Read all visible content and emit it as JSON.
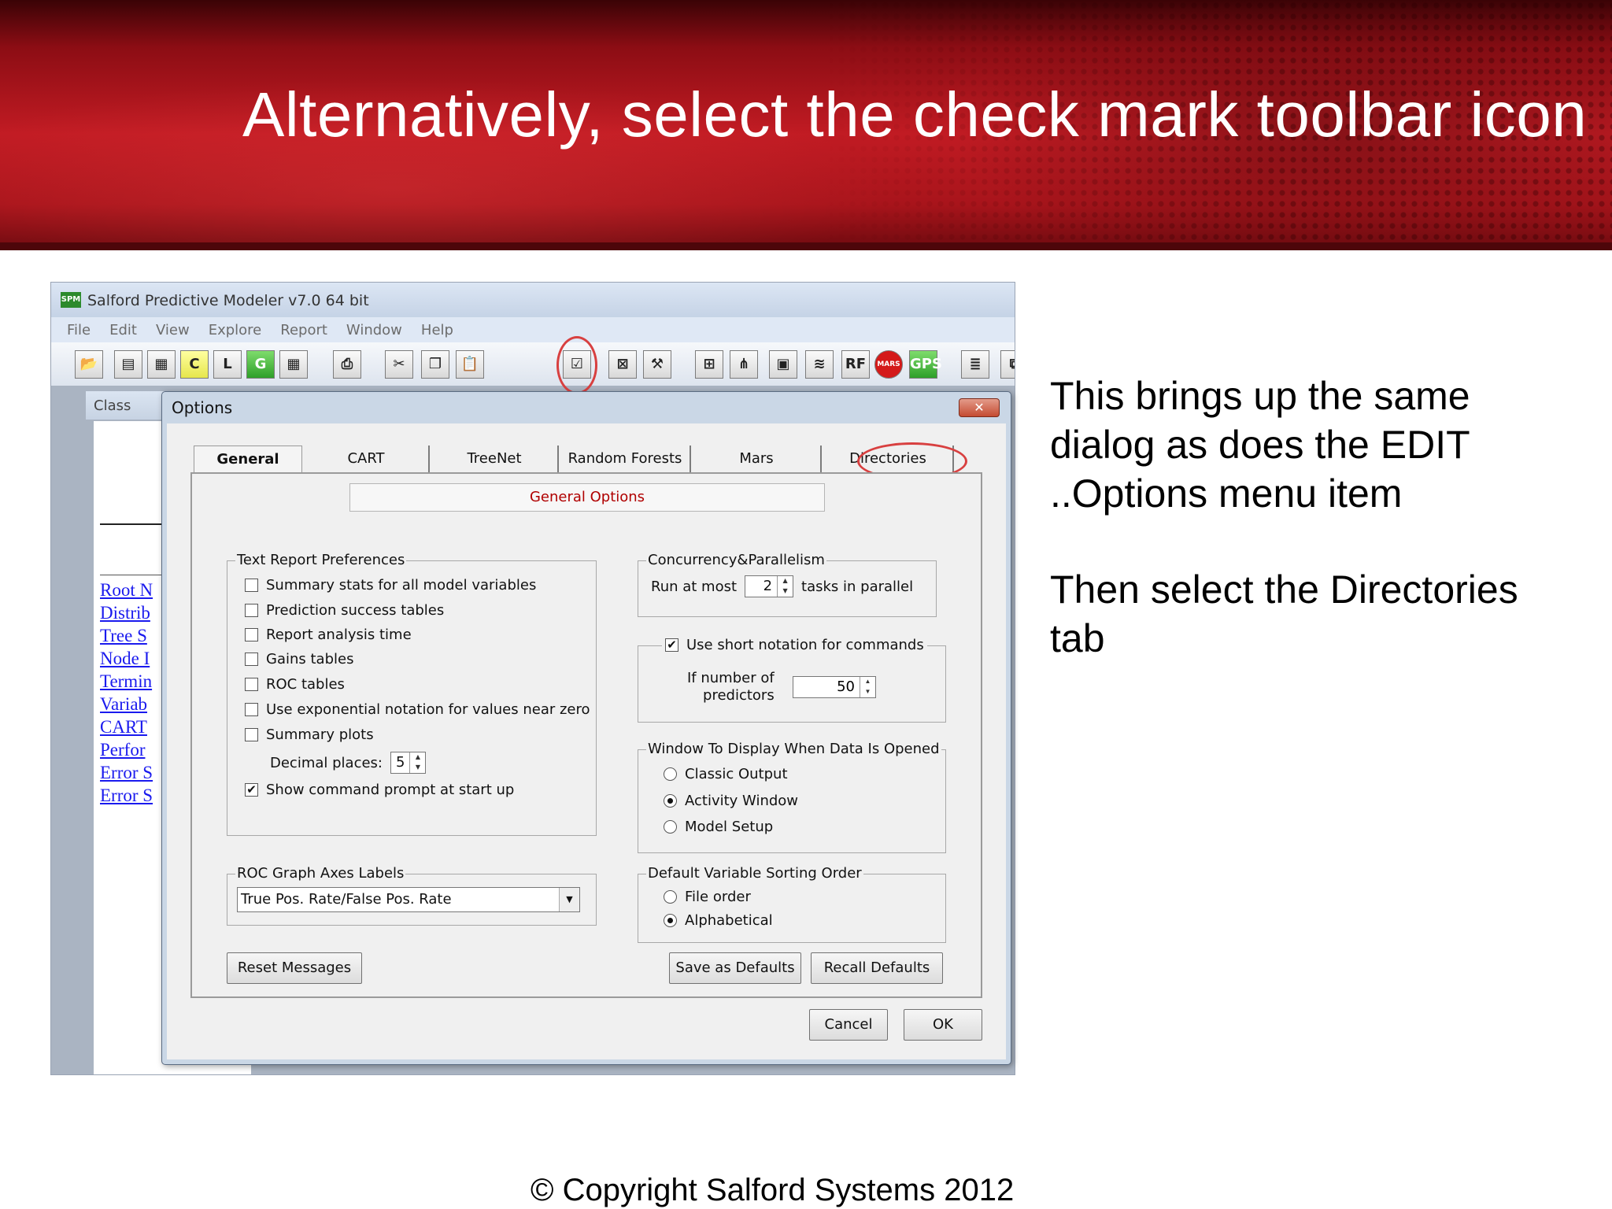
{
  "slide": {
    "title": "Alternatively, select the check mark toolbar icon",
    "side_text_1": "This brings up the same dialog as does the EDIT ..Options menu item",
    "side_text_2": "Then select the Directories tab",
    "copyright": "© Copyright Salford Systems 2012"
  },
  "app": {
    "logo": "SPM",
    "title": "Salford Predictive Modeler v7.0 64 bit",
    "menu": [
      "File",
      "Edit",
      "View",
      "Explore",
      "Report",
      "Window",
      "Help"
    ],
    "toolbar_icons": [
      "open-folder-icon",
      "properties-icon",
      "data-grid-icon",
      "c-icon",
      "l-icon",
      "g-icon",
      "table-icon",
      "print-icon",
      "cut-icon",
      "copy-icon",
      "paste-icon",
      "options-checkmark-icon",
      "model-icon",
      "tools-icon",
      "cart-icon",
      "treenet-icon",
      "votes-icon",
      "batteries-icon",
      "random-forests-icon",
      "mars-icon",
      "gps-icon",
      "report-icon",
      "window-icon"
    ]
  },
  "child_window": {
    "title": "Class",
    "links": [
      "Root N",
      "Distrib",
      "Tree S",
      "Node I",
      "Termin",
      "Variab",
      "CART",
      "Perfor",
      "Error S",
      "Error S"
    ]
  },
  "dialog": {
    "title": "Options",
    "close_label": "✕",
    "tabs": [
      "General",
      "CART",
      "TreeNet",
      "Random Forests",
      "Mars",
      "Directories"
    ],
    "active_tab": "General",
    "page_header": "General Options",
    "text_report": {
      "label": "Text Report Preferences",
      "items": [
        {
          "label": "Summary stats for all model variables",
          "checked": false
        },
        {
          "label": "Prediction success tables",
          "checked": false
        },
        {
          "label": "Report analysis time",
          "checked": false
        },
        {
          "label": "Gains tables",
          "checked": false
        },
        {
          "label": "ROC tables",
          "checked": false
        },
        {
          "label": "Use exponential notation for values near zero",
          "checked": false
        },
        {
          "label": "Summary plots",
          "checked": false
        }
      ],
      "decimal_label": "Decimal places:",
      "decimal_value": "5",
      "show_prompt_label": "Show command prompt at start up",
      "show_prompt_checked": true
    },
    "roc": {
      "label": "ROC Graph Axes Labels",
      "value": "True Pos. Rate/False Pos. Rate"
    },
    "reset_label": "Reset Messages",
    "concurrency": {
      "label": "Concurrency&Parallelism",
      "run_label": "Run at most",
      "run_value": "2",
      "tasks_label": "tasks in parallel"
    },
    "short_notation": {
      "label": "Use short notation for commands",
      "checked": true,
      "predictors_label_1": "If number of",
      "predictors_label_2": "predictors",
      "predictors_value": "50"
    },
    "window_display": {
      "label": "Window To Display When Data Is Opened",
      "options": [
        "Classic Output",
        "Activity Window",
        "Model Setup"
      ],
      "selected": "Activity Window"
    },
    "sorting": {
      "label": "Default Variable Sorting Order",
      "options": [
        "File order",
        "Alphabetical"
      ],
      "selected": "Alphabetical"
    },
    "save_defaults_label": "Save as Defaults",
    "recall_defaults_label": "Recall Defaults",
    "cancel_label": "Cancel",
    "ok_label": "OK"
  },
  "colors": {
    "banner_red": "#c11b23",
    "highlight_circle": "#d84040",
    "page_header_text": "#b00000",
    "link_blue": "#1a1aee"
  }
}
